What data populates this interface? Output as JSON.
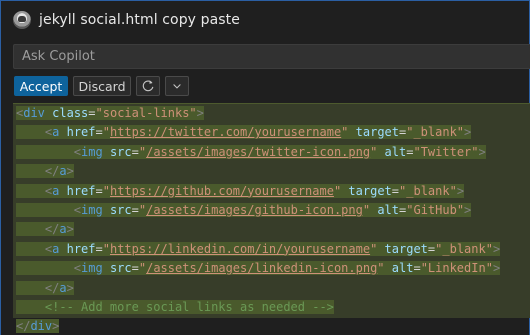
{
  "title": "jekyll social.html copy paste",
  "input": {
    "placeholder": "Ask Copilot",
    "value": ""
  },
  "toolbar": {
    "accept_label": "Accept",
    "discard_label": "Discard",
    "rerun_icon": "refresh-icon",
    "more_icon": "chevron-down-icon"
  },
  "colors": {
    "accent": "#0e639c",
    "diff_background": "#373d29",
    "tag": "#569cd6",
    "attribute": "#9cdcfe",
    "string": "#ce9178",
    "comment": "#6a9955"
  },
  "code_lines": [
    [
      [
        "t-punc",
        "<"
      ],
      [
        "t-tag",
        "div"
      ],
      [
        "t-plain",
        " "
      ],
      [
        "t-attr",
        "class"
      ],
      [
        "t-eq",
        "="
      ],
      [
        "t-str",
        "\"social-links\""
      ],
      [
        "t-punc",
        ">"
      ]
    ],
    [
      [
        "t-plain",
        "    "
      ],
      [
        "t-punc",
        "<"
      ],
      [
        "t-tag",
        "a"
      ],
      [
        "t-plain",
        " "
      ],
      [
        "t-attr",
        "href"
      ],
      [
        "t-eq",
        "="
      ],
      [
        "t-str",
        "\""
      ],
      [
        "t-url",
        "https://twitter.com/yourusername"
      ],
      [
        "t-str",
        "\""
      ],
      [
        "t-plain",
        " "
      ],
      [
        "t-attr",
        "target"
      ],
      [
        "t-eq",
        "="
      ],
      [
        "t-str",
        "\"_blank\""
      ],
      [
        "t-punc",
        ">"
      ]
    ],
    [
      [
        "t-plain",
        "        "
      ],
      [
        "t-punc",
        "<"
      ],
      [
        "t-tag",
        "img"
      ],
      [
        "t-plain",
        " "
      ],
      [
        "t-attr",
        "src"
      ],
      [
        "t-eq",
        "="
      ],
      [
        "t-str",
        "\""
      ],
      [
        "t-url",
        "/assets/images/twitter-icon.png"
      ],
      [
        "t-str",
        "\""
      ],
      [
        "t-plain",
        " "
      ],
      [
        "t-attr",
        "alt"
      ],
      [
        "t-eq",
        "="
      ],
      [
        "t-str",
        "\"Twitter\""
      ],
      [
        "t-punc",
        ">"
      ]
    ],
    [
      [
        "t-plain",
        "    "
      ],
      [
        "t-punc",
        "</"
      ],
      [
        "t-tag",
        "a"
      ],
      [
        "t-punc",
        ">"
      ]
    ],
    [
      [
        "t-plain",
        "    "
      ],
      [
        "t-punc",
        "<"
      ],
      [
        "t-tag",
        "a"
      ],
      [
        "t-plain",
        " "
      ],
      [
        "t-attr",
        "href"
      ],
      [
        "t-eq",
        "="
      ],
      [
        "t-str",
        "\""
      ],
      [
        "t-url",
        "https://github.com/yourusername"
      ],
      [
        "t-str",
        "\""
      ],
      [
        "t-plain",
        " "
      ],
      [
        "t-attr",
        "target"
      ],
      [
        "t-eq",
        "="
      ],
      [
        "t-str",
        "\"_blank\""
      ],
      [
        "t-punc",
        ">"
      ]
    ],
    [
      [
        "t-plain",
        "        "
      ],
      [
        "t-punc",
        "<"
      ],
      [
        "t-tag",
        "img"
      ],
      [
        "t-plain",
        " "
      ],
      [
        "t-attr",
        "src"
      ],
      [
        "t-eq",
        "="
      ],
      [
        "t-str",
        "\""
      ],
      [
        "t-url",
        "/assets/images/github-icon.png"
      ],
      [
        "t-str",
        "\""
      ],
      [
        "t-plain",
        " "
      ],
      [
        "t-attr",
        "alt"
      ],
      [
        "t-eq",
        "="
      ],
      [
        "t-str",
        "\"GitHub\""
      ],
      [
        "t-punc",
        ">"
      ]
    ],
    [
      [
        "t-plain",
        "    "
      ],
      [
        "t-punc",
        "</"
      ],
      [
        "t-tag",
        "a"
      ],
      [
        "t-punc",
        ">"
      ]
    ],
    [
      [
        "t-plain",
        "    "
      ],
      [
        "t-punc",
        "<"
      ],
      [
        "t-tag",
        "a"
      ],
      [
        "t-plain",
        " "
      ],
      [
        "t-attr",
        "href"
      ],
      [
        "t-eq",
        "="
      ],
      [
        "t-str",
        "\""
      ],
      [
        "t-url",
        "https://linkedin.com/in/yourusername"
      ],
      [
        "t-str",
        "\""
      ],
      [
        "t-plain",
        " "
      ],
      [
        "t-attr",
        "target"
      ],
      [
        "t-eq",
        "="
      ],
      [
        "t-str",
        "\"_blank\""
      ],
      [
        "t-punc",
        ">"
      ]
    ],
    [
      [
        "t-plain",
        "        "
      ],
      [
        "t-punc",
        "<"
      ],
      [
        "t-tag",
        "img"
      ],
      [
        "t-plain",
        " "
      ],
      [
        "t-attr",
        "src"
      ],
      [
        "t-eq",
        "="
      ],
      [
        "t-str",
        "\""
      ],
      [
        "t-url",
        "/assets/images/linkedin-icon.png"
      ],
      [
        "t-str",
        "\""
      ],
      [
        "t-plain",
        " "
      ],
      [
        "t-attr",
        "alt"
      ],
      [
        "t-eq",
        "="
      ],
      [
        "t-str",
        "\"LinkedIn\""
      ],
      [
        "t-punc",
        ">"
      ]
    ],
    [
      [
        "t-plain",
        "    "
      ],
      [
        "t-punc",
        "</"
      ],
      [
        "t-tag",
        "a"
      ],
      [
        "t-punc",
        ">"
      ]
    ],
    [
      [
        "t-plain",
        "    "
      ],
      [
        "t-com",
        "<!-- Add more social links as needed -->"
      ]
    ],
    [
      [
        "t-punc",
        "</"
      ],
      [
        "t-tag",
        "div"
      ],
      [
        "t-punc",
        ">"
      ]
    ]
  ]
}
